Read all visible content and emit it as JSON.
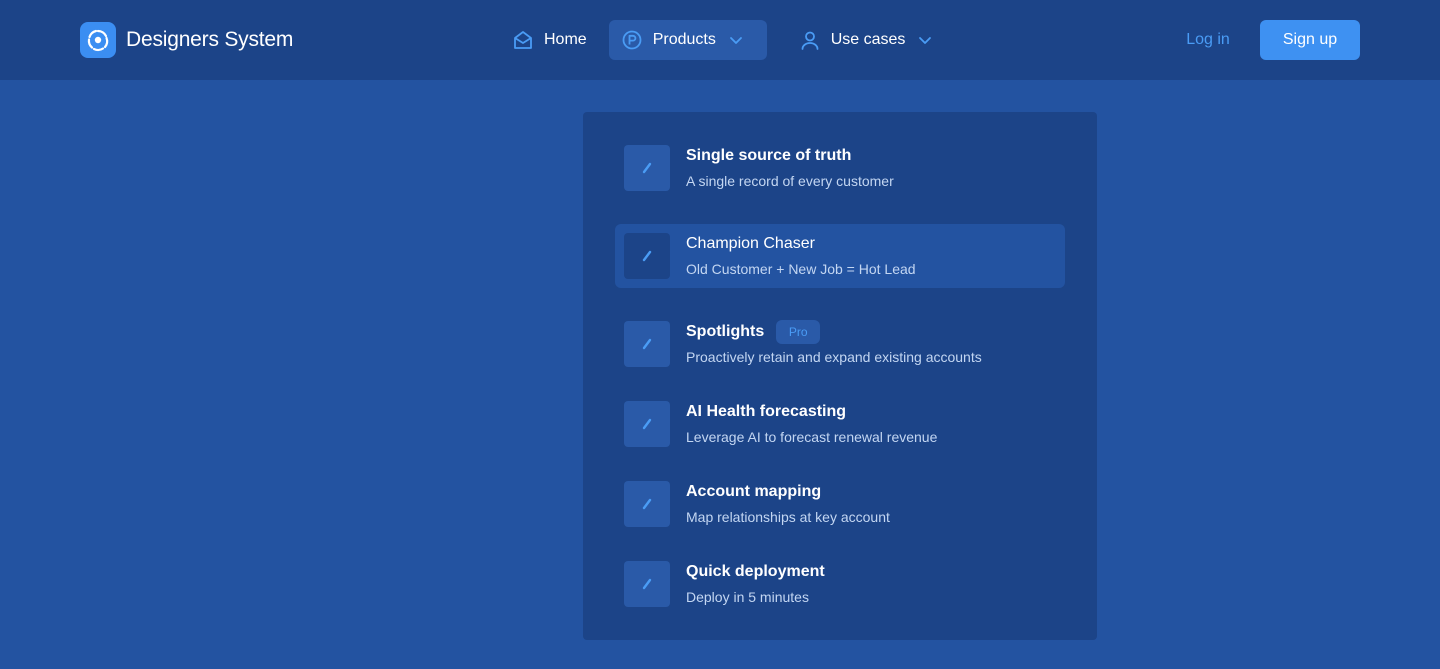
{
  "brand": {
    "name": "Designers System",
    "logo_icon": "aperture-icon",
    "accent": "#3b8ef2"
  },
  "nav": {
    "items": [
      {
        "label": "Home",
        "icon": "home-icon"
      },
      {
        "label": "Products",
        "icon": "p-circle-icon",
        "dropdown": true,
        "active": true
      },
      {
        "label": "Use cases",
        "icon": "user-icon",
        "dropdown": true
      }
    ]
  },
  "auth": {
    "login_label": "Log in",
    "signup_label": "Sign up"
  },
  "products_menu": {
    "items": [
      {
        "title": "Single source of truth",
        "description": "A single record of every customer",
        "icon": "pen-icon"
      },
      {
        "title": "Champion Chaser",
        "description": "Old Customer + New Job = Hot Lead",
        "icon": "pen-icon",
        "highlighted": true
      },
      {
        "title": "Spotlights",
        "description": "Proactively retain and expand existing accounts",
        "icon": "pen-icon",
        "badge": "Pro"
      },
      {
        "title": "AI Health forecasting",
        "description": "Leverage AI to forecast renewal revenue",
        "icon": "pen-icon"
      },
      {
        "title": "Account mapping",
        "description": "Map relationships at key account",
        "icon": "pen-icon"
      },
      {
        "title": "Quick deployment",
        "description": "Deploy in 5 minutes",
        "icon": "pen-icon"
      }
    ]
  },
  "colors": {
    "page_bg": "#2353a1",
    "header_bg": "#1c4488",
    "link": "#4a9cf5",
    "button": "#3e91f2"
  }
}
